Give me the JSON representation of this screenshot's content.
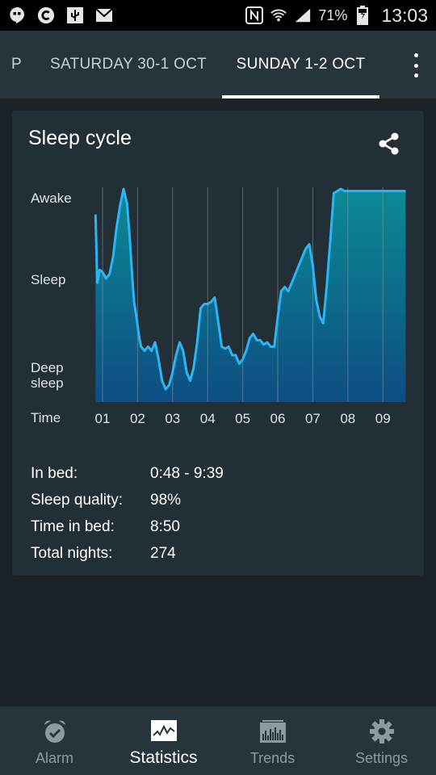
{
  "status_bar": {
    "battery_text": "71%",
    "time": "13:03",
    "icons": [
      "hangouts-icon",
      "c-app-icon",
      "usb-icon",
      "gmail-icon",
      "nfc-icon",
      "wifi-icon",
      "signal-icon",
      "battery-icon"
    ]
  },
  "tabs": {
    "items": [
      {
        "label": "P"
      },
      {
        "label": "SATURDAY 30-1 OCT"
      },
      {
        "label": "SUNDAY 1-2 OCT"
      }
    ],
    "active_index": 2
  },
  "card": {
    "title": "Sleep cycle",
    "share_icon": "share-icon"
  },
  "chart_data": {
    "type": "area",
    "title": "Sleep cycle",
    "y_levels": [
      "Awake",
      "Sleep",
      "Deep sleep"
    ],
    "y_labels": {
      "awake": "Awake",
      "sleep": "Sleep",
      "deep_line1": "Deep",
      "deep_line2": "sleep"
    },
    "x_axis_label": "Time",
    "x_ticks": [
      "01",
      "02",
      "03",
      "04",
      "05",
      "06",
      "07",
      "08",
      "09"
    ],
    "ylim": [
      0,
      1
    ],
    "grid": "vertical",
    "series": [
      {
        "color": "#29b6f6",
        "x_hours": [
          0.8,
          0.85,
          0.92,
          1.0,
          1.1,
          1.2,
          1.3,
          1.4,
          1.5,
          1.6,
          1.7,
          1.78,
          1.85,
          1.9,
          1.95,
          2.0,
          2.05,
          2.1,
          2.2,
          2.3,
          2.4,
          2.5,
          2.6,
          2.7,
          2.8,
          2.9,
          3.0,
          3.1,
          3.2,
          3.3,
          3.4,
          3.5,
          3.6,
          3.7,
          3.8,
          3.9,
          4.0,
          4.1,
          4.2,
          4.3,
          4.4,
          4.5,
          4.6,
          4.7,
          4.8,
          4.9,
          5.0,
          5.1,
          5.2,
          5.3,
          5.4,
          5.5,
          5.6,
          5.7,
          5.8,
          5.9,
          6.0,
          6.1,
          6.2,
          6.3,
          6.4,
          6.5,
          6.6,
          6.7,
          6.8,
          6.9,
          7.0,
          7.1,
          7.2,
          7.3,
          7.4,
          7.5,
          7.6,
          7.7,
          7.8,
          7.9,
          8.0,
          8.1,
          8.2,
          8.3,
          8.4,
          8.5,
          8.6,
          8.7,
          8.8,
          8.9,
          9.0,
          9.1,
          9.2,
          9.3,
          9.4,
          9.5,
          9.6,
          9.65
        ],
        "values": [
          0.88,
          0.56,
          0.62,
          0.61,
          0.58,
          0.6,
          0.68,
          0.82,
          0.92,
          1.0,
          0.93,
          0.76,
          0.58,
          0.47,
          0.42,
          0.36,
          0.3,
          0.26,
          0.24,
          0.26,
          0.24,
          0.28,
          0.2,
          0.1,
          0.06,
          0.08,
          0.14,
          0.22,
          0.28,
          0.24,
          0.14,
          0.1,
          0.16,
          0.28,
          0.44,
          0.46,
          0.46,
          0.47,
          0.49,
          0.38,
          0.26,
          0.25,
          0.26,
          0.22,
          0.22,
          0.18,
          0.2,
          0.24,
          0.3,
          0.32,
          0.29,
          0.29,
          0.27,
          0.28,
          0.26,
          0.26,
          0.4,
          0.52,
          0.54,
          0.52,
          0.56,
          0.6,
          0.64,
          0.68,
          0.72,
          0.74,
          0.64,
          0.48,
          0.4,
          0.37,
          0.55,
          0.76,
          0.98,
          0.99,
          1.0,
          0.99,
          0.99,
          0.99,
          0.99,
          0.99,
          0.99,
          0.99,
          0.99,
          0.99,
          0.99,
          0.99,
          0.99,
          0.99,
          0.99,
          0.99,
          0.99,
          0.99,
          0.99,
          0.99
        ]
      }
    ]
  },
  "stats": {
    "in_bed_label": "In bed:",
    "in_bed_value": "0:48 - 9:39",
    "quality_label": "Sleep quality:",
    "quality_value": "98%",
    "time_in_bed_label": "Time in bed:",
    "time_in_bed_value": "8:50",
    "total_nights_label": "Total nights:",
    "total_nights_value": "274"
  },
  "bottom_nav": {
    "items": [
      {
        "label": "Alarm",
        "icon": "alarm-clock-icon"
      },
      {
        "label": "Statistics",
        "icon": "statistics-graph-icon"
      },
      {
        "label": "Trends",
        "icon": "trends-bars-icon"
      },
      {
        "label": "Settings",
        "icon": "gear-icon"
      }
    ],
    "active_index": 1
  }
}
